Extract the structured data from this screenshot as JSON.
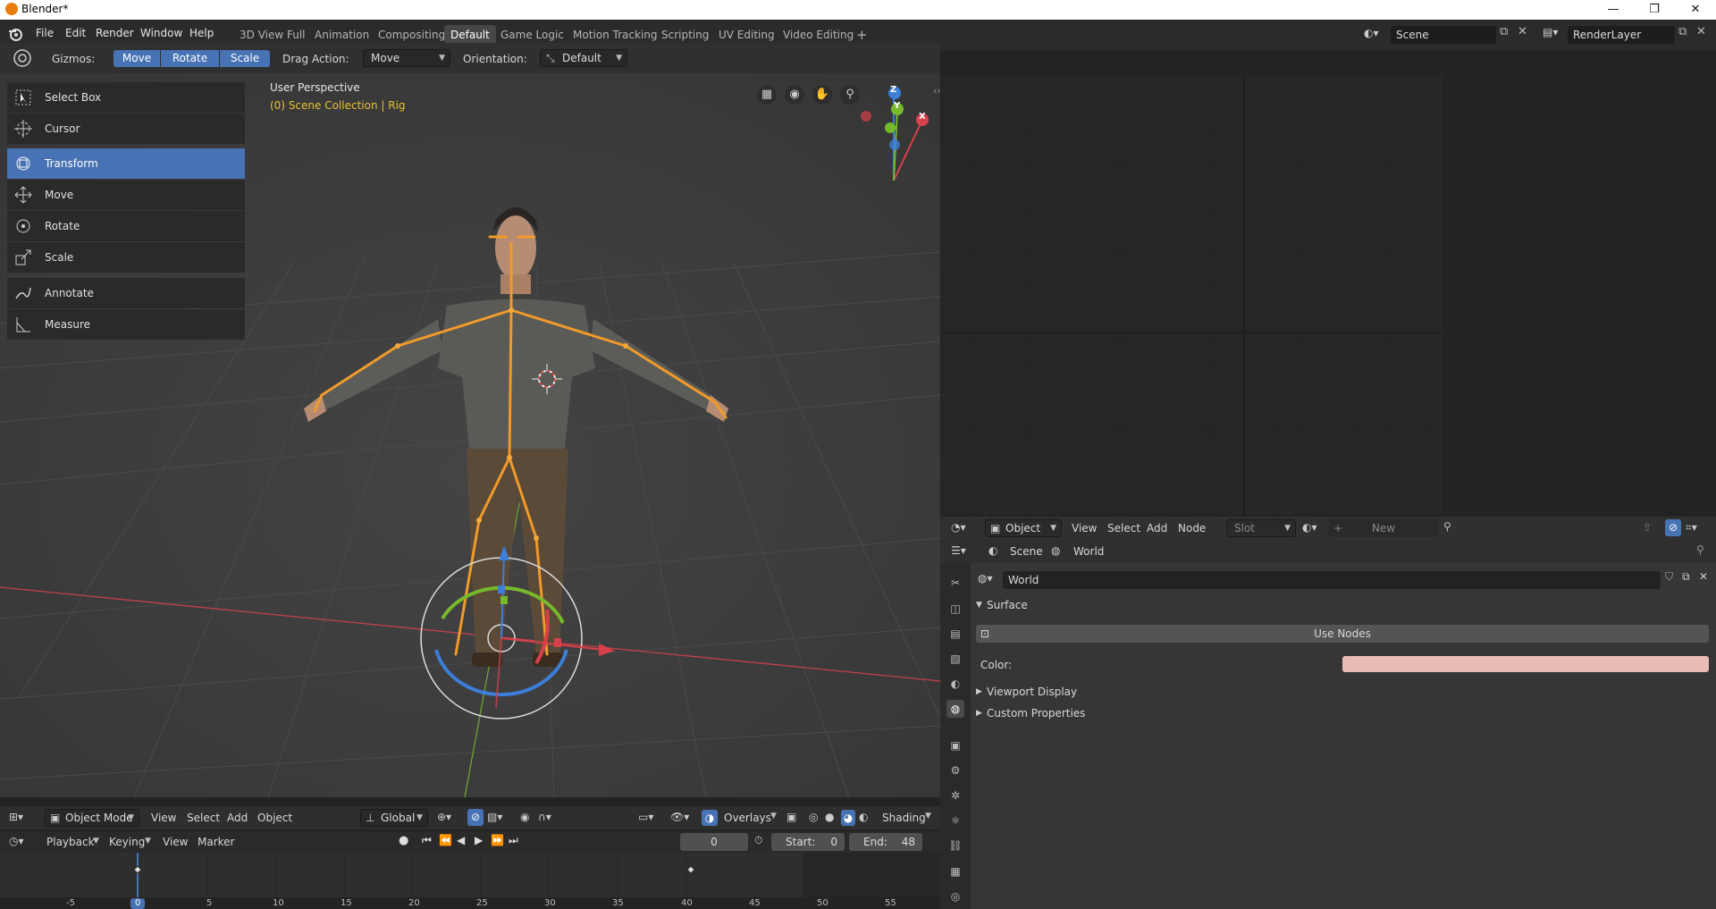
{
  "window": {
    "title": "Blender*",
    "controls": [
      "—",
      "❐",
      "✕"
    ]
  },
  "menu": [
    "File",
    "Edit",
    "Render",
    "Window",
    "Help"
  ],
  "workspaces": [
    {
      "label": "3D View Full"
    },
    {
      "label": "Animation"
    },
    {
      "label": "Compositing"
    },
    {
      "label": "Default",
      "active": true
    },
    {
      "label": "Game Logic"
    },
    {
      "label": "Motion Tracking"
    },
    {
      "label": "Scripting"
    },
    {
      "label": "UV Editing"
    },
    {
      "label": "Video Editing"
    }
  ],
  "add_workspace": "+",
  "scene": {
    "value": "Scene"
  },
  "render_layer": {
    "value": "RenderLayer"
  },
  "tool_header": {
    "gizmos_label": "Gizmos:",
    "gizmo_buttons": [
      "Move",
      "Rotate",
      "Scale"
    ],
    "drag_action_label": "Drag Action:",
    "drag_action_value": "Move",
    "orientation_label": "Orientation:",
    "orientation_value": "Default"
  },
  "tools": [
    {
      "label": "Select Box",
      "icon": "select-box-icon"
    },
    {
      "label": "Cursor",
      "icon": "cursor-icon"
    },
    {
      "label": "Transform",
      "icon": "transform-icon",
      "active": true
    },
    {
      "label": "Move",
      "icon": "move-icon"
    },
    {
      "label": "Rotate",
      "icon": "rotate-icon"
    },
    {
      "label": "Scale",
      "icon": "scale-icon"
    },
    {
      "label": "Annotate",
      "icon": "annotate-icon"
    },
    {
      "label": "Measure",
      "icon": "measure-icon"
    }
  ],
  "viewport": {
    "perspective": "User Perspective",
    "collection": "(0) Scene Collection | Rig",
    "axes": [
      "Z",
      "Y",
      "X"
    ],
    "colors": {
      "x_axis": "#d9404a",
      "y_axis": "#77b82d",
      "z_axis": "#3c7ed8",
      "rig": "#f09a2b",
      "active": "#4772b3"
    }
  },
  "viewport_header": {
    "mode": "Object Mode",
    "menus": [
      "View",
      "Select",
      "Add",
      "Object"
    ],
    "orientation": "Global",
    "overlays": "Overlays",
    "shading": "Shading"
  },
  "timeline_header": {
    "menus": [
      "Playback",
      "Keying",
      "View",
      "Marker"
    ],
    "current_frame": "0",
    "start_label": "Start:",
    "start_value": "0",
    "end_label": "End:",
    "end_value": "48",
    "ruler": [
      "-5",
      "0",
      "5",
      "10",
      "15",
      "20",
      "25",
      "30",
      "35",
      "40",
      "45",
      "50",
      "55"
    ]
  },
  "node_header": {
    "object": "Object",
    "menus": [
      "View",
      "Select",
      "Add",
      "Node"
    ],
    "slot": "Slot",
    "new": "New"
  },
  "properties": {
    "breadcrumb_scene": "Scene",
    "breadcrumb_world": "World",
    "world_field": "World",
    "surface_label": "Surface",
    "use_nodes": "Use Nodes",
    "color_label": "Color:",
    "color_value": "#e8bdb5",
    "viewport_display": "Viewport Display",
    "custom_properties": "Custom Properties"
  }
}
